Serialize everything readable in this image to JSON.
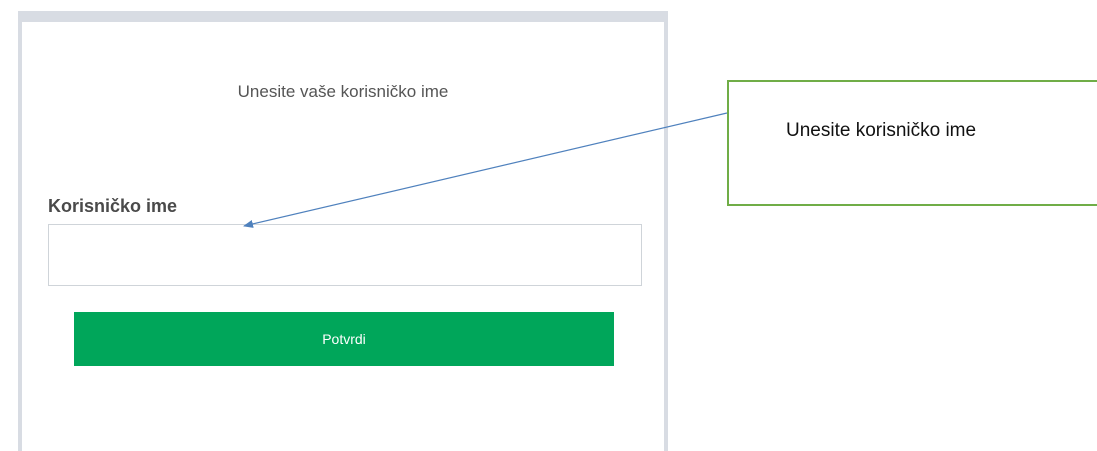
{
  "login": {
    "heading": "Unesite vaše korisničko ime",
    "username_label": "Korisničko ime",
    "username_value": "",
    "username_placeholder": "",
    "submit_label": "Potvrdi"
  },
  "callout": {
    "text": "Unesite korisničko ime"
  },
  "colors": {
    "button": "#00a65a",
    "callout_border": "#70ad47",
    "arrow": "#4f81bd",
    "panel_frame": "#d8dce3"
  }
}
